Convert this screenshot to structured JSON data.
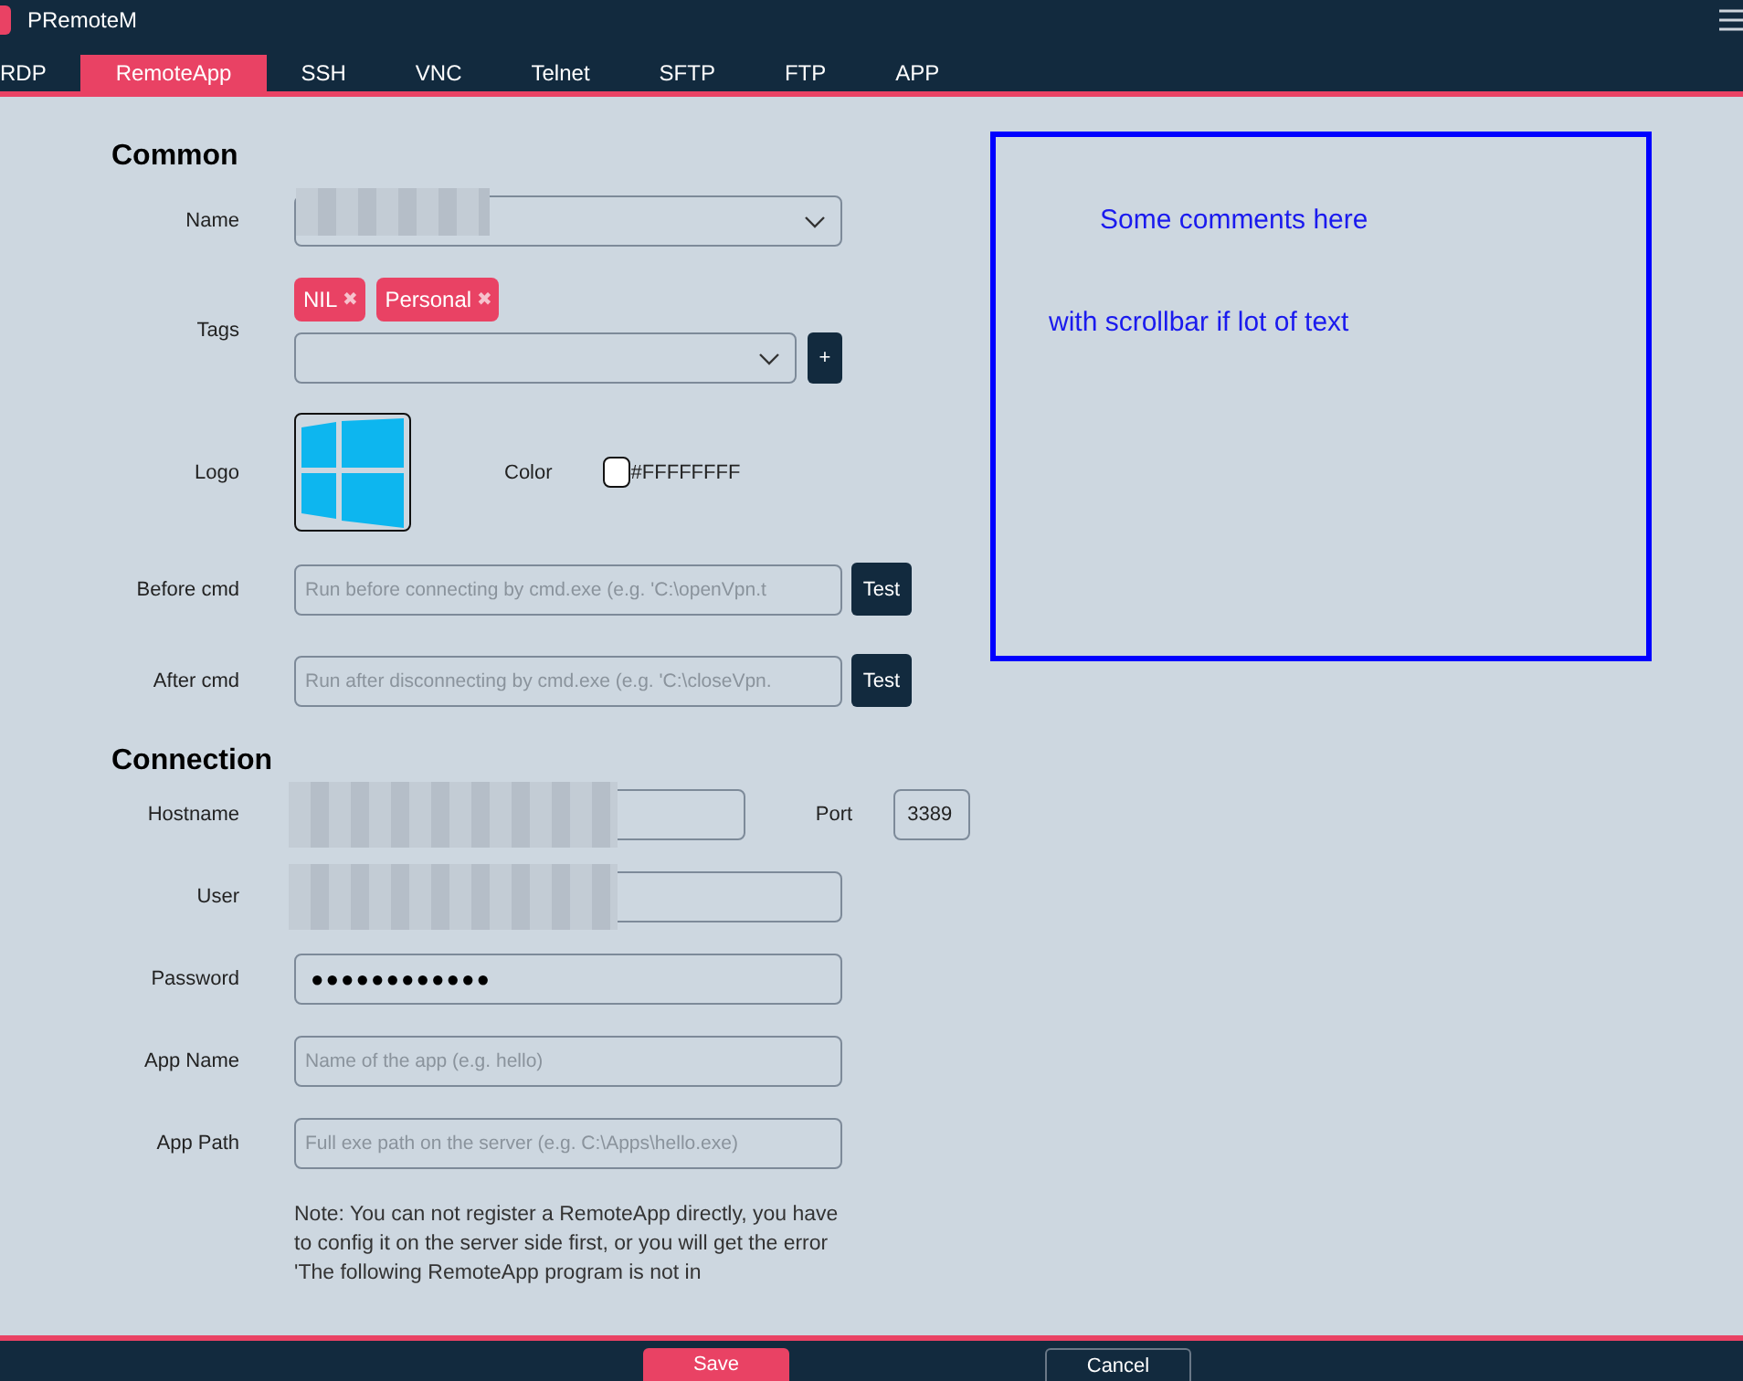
{
  "window": {
    "title": "PRemoteM"
  },
  "tabs": [
    {
      "label": "RDP",
      "selected": false
    },
    {
      "label": "RemoteApp",
      "selected": true
    },
    {
      "label": "SSH",
      "selected": false
    },
    {
      "label": "VNC",
      "selected": false
    },
    {
      "label": "Telnet",
      "selected": false
    },
    {
      "label": "SFTP",
      "selected": false
    },
    {
      "label": "FTP",
      "selected": false
    },
    {
      "label": "APP",
      "selected": false
    }
  ],
  "common": {
    "heading": "Common",
    "name": {
      "label": "Name"
    },
    "tags": {
      "label": "Tags",
      "items": [
        {
          "label": "NIL",
          "remove": "✖"
        },
        {
          "label": "Personal",
          "remove": "✖"
        }
      ],
      "add": "+"
    },
    "logo": {
      "label": "Logo"
    },
    "color": {
      "label": "Color",
      "value": "#FFFFFFFF"
    },
    "commands": [
      {
        "label": "Before cmd",
        "placeholder": "Run before connecting by cmd.exe (e.g. 'C:\\openVpn.t",
        "button": "Test"
      },
      {
        "label": "After cmd",
        "placeholder": "Run after disconnecting by cmd.exe (e.g. 'C:\\closeVpn.",
        "button": "Test"
      }
    ]
  },
  "comments": [
    "Some comments here",
    "with scrollbar if lot of text"
  ],
  "connection": {
    "heading": "Connection",
    "fields": [
      {
        "kind": "redacted",
        "label": "Hostname"
      },
      {
        "kind": "redacted",
        "label": "User"
      },
      {
        "kind": "password",
        "label": "Password",
        "value": "●●●●●●●●●●●●"
      },
      {
        "kind": "text",
        "label": "App Name",
        "placeholder": "Name of the app (e.g. hello)"
      },
      {
        "kind": "text",
        "label": "App Path",
        "placeholder": "Full exe path on the server (e.g. C:\\Apps\\hello.exe)"
      }
    ],
    "port": {
      "label": "Port",
      "value": "3389"
    },
    "note": "Note: You can not register a RemoteApp directly, you have to config it on the server side first, or you will get the error 'The following RemoteApp program is not in"
  },
  "footer": {
    "buttons": [
      "Save",
      "Cancel"
    ]
  }
}
